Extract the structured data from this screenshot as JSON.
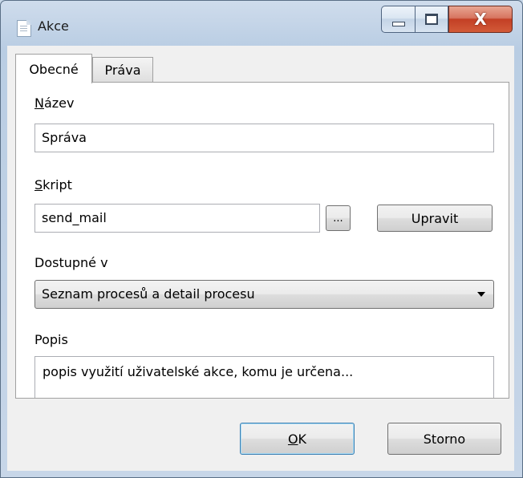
{
  "window": {
    "title": "Akce",
    "close_glyph": "X"
  },
  "icons": {
    "app": "document-icon",
    "minimize": "minimize-icon",
    "maximize": "maximize-icon",
    "close": "close-icon",
    "dropdown": "chevron-down-icon"
  },
  "tabs": [
    {
      "label": "Obecné",
      "active": true
    },
    {
      "label": "Práva",
      "active": false
    }
  ],
  "form": {
    "nazev": {
      "label_mnemonic": "N",
      "label_rest": "ázev",
      "value": "Správa"
    },
    "skript": {
      "label_mnemonic": "S",
      "label_rest": "kript",
      "value": "send_mail",
      "browse_label": "...",
      "edit_label": "Upravit"
    },
    "dostupne": {
      "label": "Dostupné v",
      "selected": "Seznam procesů a detail procesu"
    },
    "popis": {
      "label": "Popis",
      "value": "popis využití uživatelské akce, komu je určena..."
    }
  },
  "footer": {
    "ok_mnemonic": "O",
    "ok_rest": "K",
    "cancel_label": "Storno"
  },
  "colors": {
    "close_button": "#c33f25",
    "ok_border": "#3c7fb1",
    "titlebar": "#b9cde3"
  }
}
